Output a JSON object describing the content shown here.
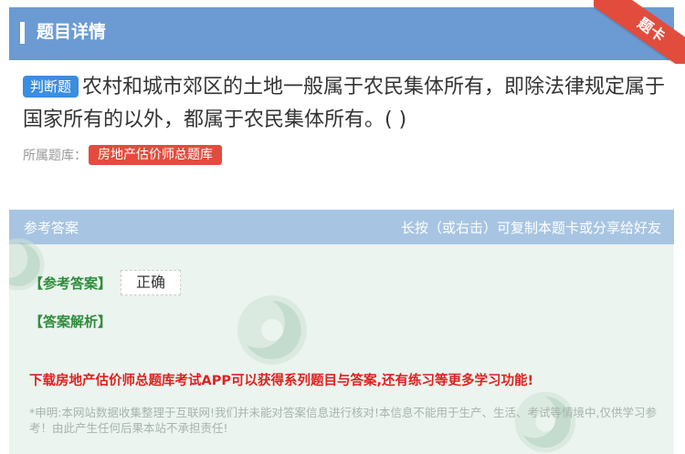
{
  "header": {
    "title": "题目详情"
  },
  "ribbon": {
    "label": "题卡"
  },
  "question": {
    "type_badge": "判断题",
    "text": "农村和城市郊区的土地一般属于农民集体所有，即除法律规定属于国家所有的以外，都属于农民集体所有。( )"
  },
  "source": {
    "label": "所属题库：",
    "tag": "房地产估价师总题库"
  },
  "answer_panel": {
    "header_left": "参考答案",
    "header_right": "长按（或右击）可复制本题卡或分享给好友",
    "answer_label": "【参考答案】",
    "answer_value": "正确",
    "analysis_label": "【答案解析】",
    "promo": "下载房地产估价师总题库考试APP可以获得系列题目与答案,还有练习等更多学习功能!",
    "disclaimer": "*申明:本网站数据收集整理于互联网!我们并未能对答案信息进行核对!本信息不能用于生产、生活、考试等情境中,仅供学习参考！由此产生任何后果本站不承担责任!"
  },
  "colors": {
    "header_bg": "#6b9bd2",
    "badge_blue": "#3b8de0",
    "tag_red": "#e44b3e",
    "answer_green": "#2f8c3c",
    "promo_red": "#e02020"
  }
}
